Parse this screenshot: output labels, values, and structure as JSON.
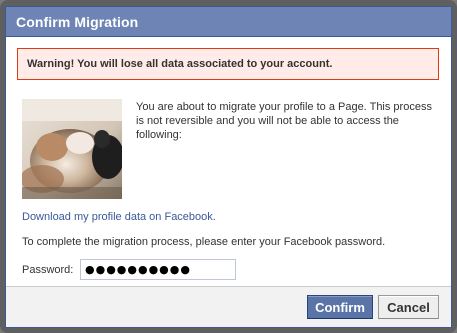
{
  "dialog": {
    "title": "Confirm Migration"
  },
  "warning": {
    "text": "Warning! You will lose all data associated to your account."
  },
  "message": {
    "text": "You are about to migrate your profile to a Page. This process is not reversible and you will not be able to access the following:"
  },
  "download": {
    "link_text": "Download my profile data on Facebook."
  },
  "instructions": {
    "text": "To complete the migration process, please enter your Facebook password."
  },
  "password": {
    "label": "Password:",
    "value": "●●●●●●●●●●"
  },
  "buttons": {
    "confirm_label": "Confirm",
    "cancel_label": "Cancel"
  },
  "colors": {
    "title_bar": "#6d84b4",
    "brand_border": "#3b5998",
    "warning_bg": "#ffebe8",
    "warning_border": "#dd3c10",
    "link": "#3b5998",
    "confirm_button": "#5b74a8"
  }
}
